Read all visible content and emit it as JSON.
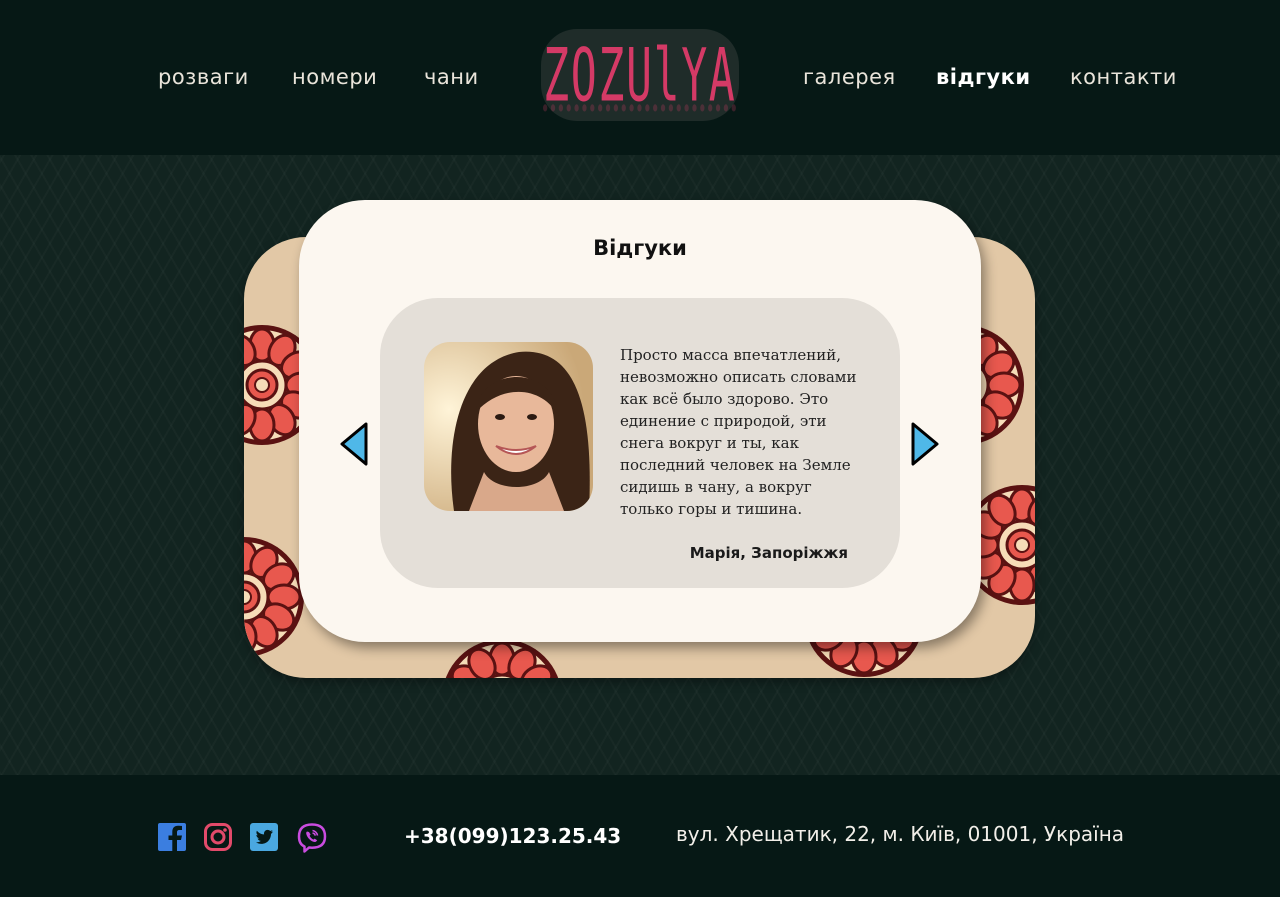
{
  "nav": {
    "left": [
      {
        "label": "розваги"
      },
      {
        "label": "номери"
      },
      {
        "label": "чани"
      }
    ],
    "logo_text": "ZOZUlYA",
    "right": [
      {
        "label": "галерея"
      },
      {
        "label": "відгуки",
        "active": true
      },
      {
        "label": "контакти"
      }
    ]
  },
  "reviews": {
    "title": "Відгуки",
    "current": {
      "text": "Просто масса впечатлений,\nневозможно описать словами\nкак всё было здорово. Это\nединение с природой, эти\nснега вокруг и ты, как\nпоследний человек на Земле\nсидишь в чану, а вокруг\nтолько горы и тишина.",
      "author": "Марія, Запоріжжя"
    },
    "prev_icon": "arrow-left-icon",
    "next_icon": "arrow-right-icon"
  },
  "footer": {
    "social": [
      {
        "icon": "facebook-icon"
      },
      {
        "icon": "instagram-icon"
      },
      {
        "icon": "twitter-icon"
      },
      {
        "icon": "viber-icon"
      }
    ],
    "phone": "+38(099)123.25.43",
    "address": "вул. Хрещатик, 22, м. Київ, 01001, Україна"
  },
  "colors": {
    "header_bg": "#061815",
    "logo_accent": "#d43a66",
    "card_bg": "#fcf7f0",
    "review_bg": "#e4dfd8",
    "arrow": "#4fb8e8",
    "pattern_red": "#e8584e",
    "pattern_dark": "#5a1212"
  }
}
